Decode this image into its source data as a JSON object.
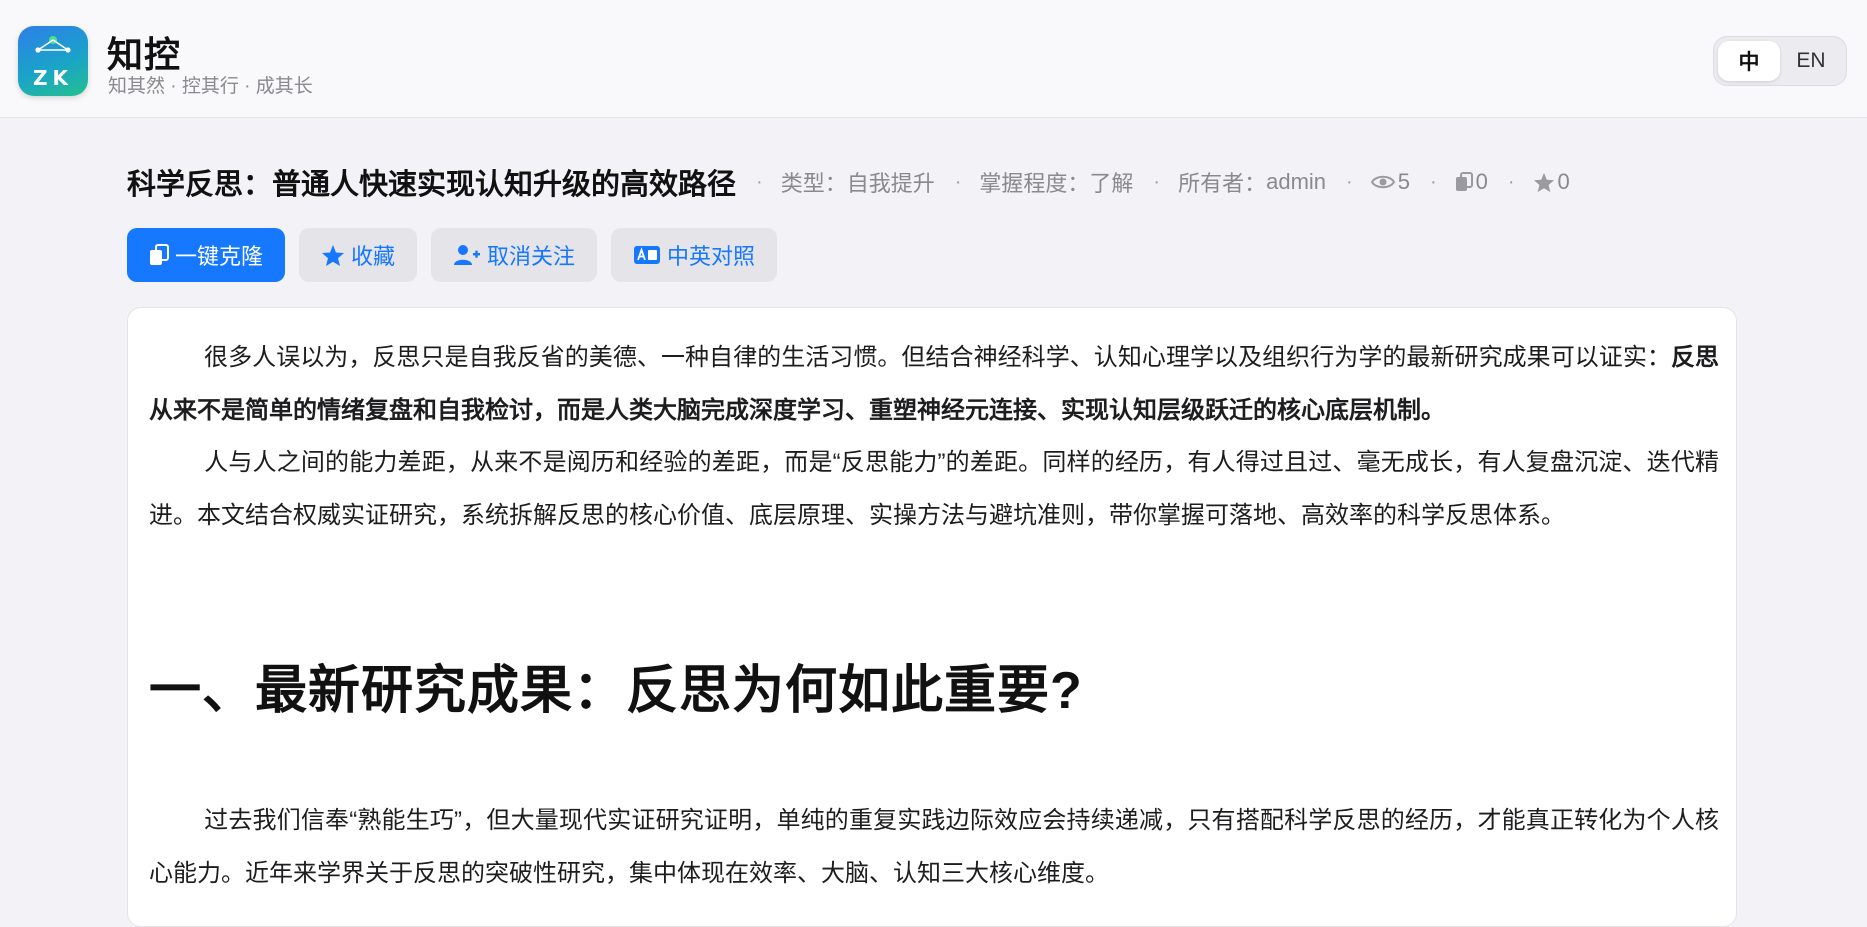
{
  "header": {
    "logo_text": "ZK",
    "brand_name": "知控",
    "tagline": "知其然 · 控其行 · 成其长",
    "lang_options": [
      "中",
      "EN"
    ],
    "lang_selected": "中"
  },
  "article": {
    "title": "科学反思：普通人快速实现认知升级的高效路径",
    "meta": {
      "type_label": "类型：",
      "type_value": "自我提升",
      "mastery_label": "掌握程度：",
      "mastery_value": "了解",
      "owner_label": "所有者：",
      "owner_value": "admin",
      "views": "5",
      "clones": "0",
      "stars": "0"
    },
    "actions": {
      "clone": "一键克隆",
      "favorite": "收藏",
      "unfollow": "取消关注",
      "bilingual": "中英对照"
    },
    "p1_normal": "很多人误以为，反思只是自我反省的美德、一种自律的生活习惯。但结合神经科学、认知心理学以及组织行为学的最新研究成果可以证实：",
    "p1_bold": "反思从来不是简单的情绪复盘和自我检讨，而是人类大脑完成深度学习、重塑神经元连接、实现认知层级跃迁的核心底层机制。",
    "p2": "人与人之间的能力差距，从来不是阅历和经验的差距，而是“反思能力”的差距。同样的经历，有人得过且过、毫无成长，有人复盘沉淀、迭代精进。本文结合权威实证研究，系统拆解反思的核心价值、底层原理、实操方法与避坑准则，带你掌握可落地、高效率的科学反思体系。",
    "heading1": "一、最新研究成果：反思为何如此重要?",
    "p3": "过去我们信奉“熟能生巧”，但大量现代实证研究证明，单纯的重复实践边际效应会持续递减，只有搭配科学反思的经历，才能真正转化为个人核心能力。近年来学界关于反思的突破性研究，集中体现在效率、大脑、认知三大核心维度。"
  },
  "colors": {
    "primary": "#1677ff",
    "background": "#f2f2f7",
    "muted": "#8a8a8e"
  },
  "icons": [
    "app-logo-icon",
    "clone-icon",
    "star-icon",
    "user-plus-icon",
    "translate-icon",
    "eye-icon",
    "copy-icon"
  ]
}
